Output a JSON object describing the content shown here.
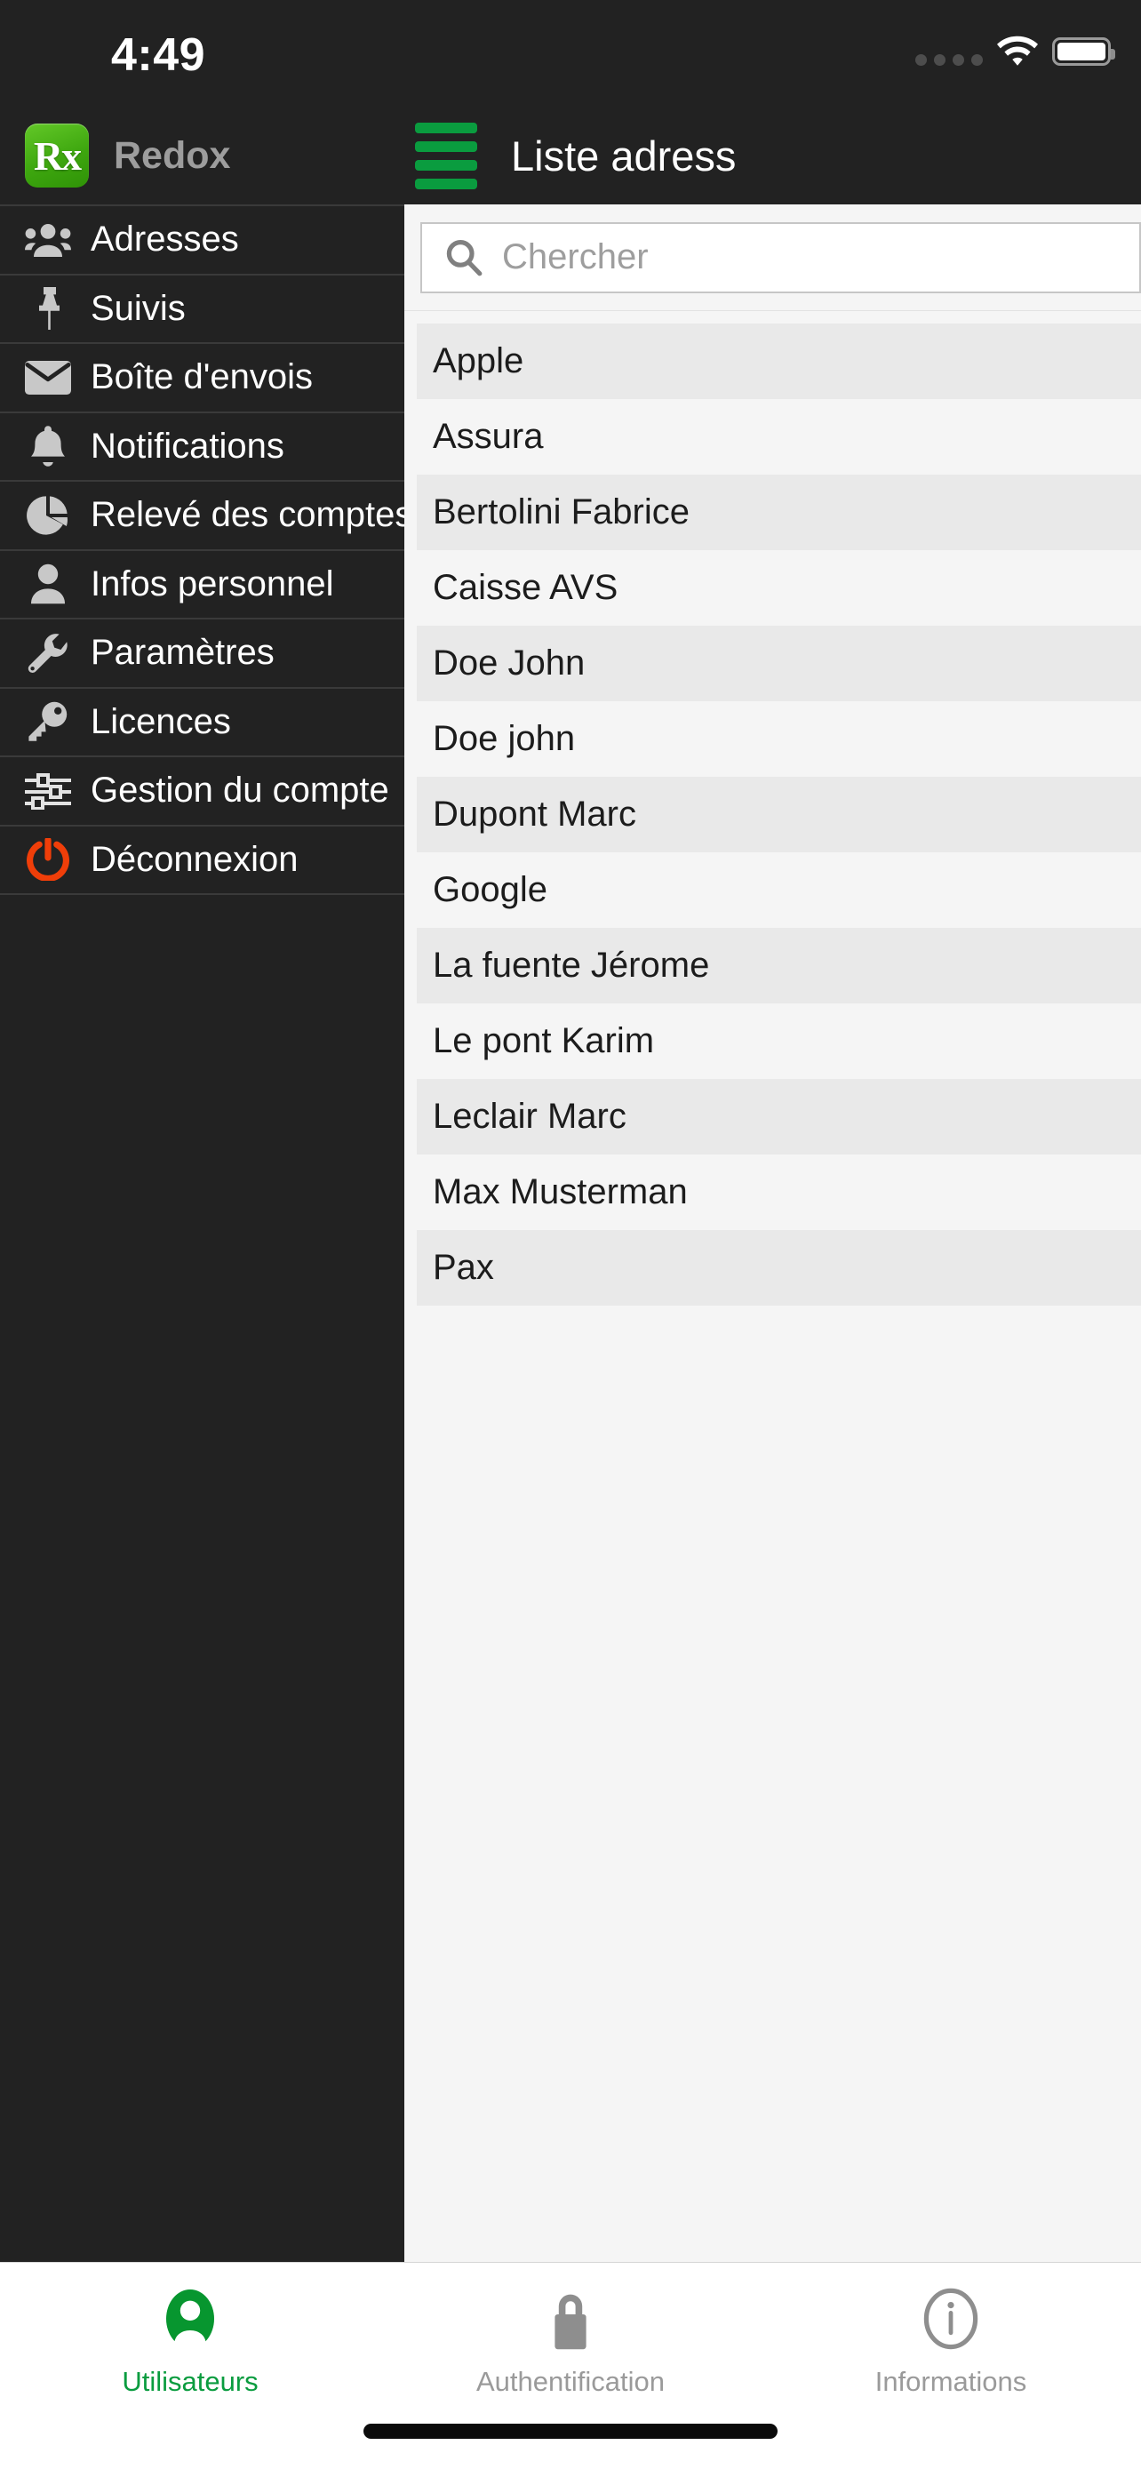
{
  "status_bar": {
    "time": "4:49",
    "signal_icon": "signal-dots-icon",
    "wifi_icon": "wifi-icon",
    "battery_icon": "battery-full-icon"
  },
  "header": {
    "app_logo": "rx-logo-icon",
    "app_logo_text": "Rx",
    "app_name": "Redox",
    "menu_icon": "hamburger-menu-icon",
    "nav_title": "Liste adress"
  },
  "sidebar": {
    "items": [
      {
        "label": "Adresses",
        "icon": "people-icon"
      },
      {
        "label": "Suivis",
        "icon": "pin-icon"
      },
      {
        "label": "Boîte d'envois",
        "icon": "envelope-icon"
      },
      {
        "label": "Notifications",
        "icon": "bell-icon"
      },
      {
        "label": "Relevé des comptes",
        "icon": "pie-chart-icon"
      },
      {
        "label": "Infos personnel",
        "icon": "person-icon"
      },
      {
        "label": "Paramètres",
        "icon": "wrench-icon"
      },
      {
        "label": "Licences",
        "icon": "key-icon"
      },
      {
        "label": "Gestion du compte",
        "icon": "sliders-icon"
      },
      {
        "label": "Déconnexion",
        "icon": "power-icon"
      }
    ]
  },
  "search": {
    "icon": "search-icon",
    "placeholder": "Chercher",
    "value": ""
  },
  "address_list": {
    "items": [
      "Apple",
      "Assura",
      "Bertolini Fabrice",
      "Caisse AVS",
      "Doe John",
      "Doe john",
      "Dupont Marc",
      "Google",
      "La fuente Jérome",
      "Le pont Karim",
      "Leclair Marc",
      "Max Musterman",
      "Pax"
    ]
  },
  "tab_bar": {
    "tabs": [
      {
        "label": "Utilisateurs",
        "icon": "user-circle-icon",
        "active": true
      },
      {
        "label": "Authentification",
        "icon": "lock-icon",
        "active": false
      },
      {
        "label": "Informations",
        "icon": "info-circle-icon",
        "active": false
      }
    ]
  },
  "colors": {
    "brand_green": "#0a9c3f",
    "logout_orange": "#f03e09",
    "sidebar_bg": "#222222",
    "content_bg": "#f5f5f5",
    "row_alt_bg": "#e9e9e9"
  }
}
